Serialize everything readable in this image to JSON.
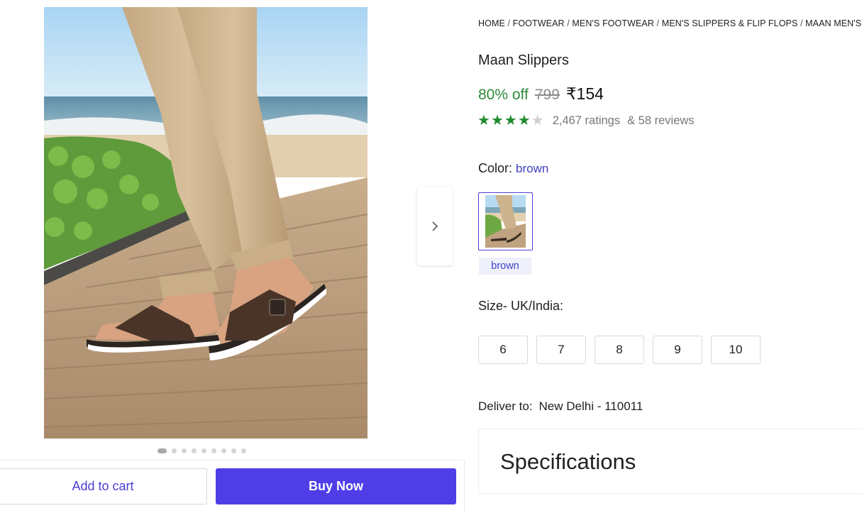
{
  "breadcrumb": [
    {
      "label": "HOME"
    },
    {
      "label": "FOOTWEAR"
    },
    {
      "label": "MEN'S FOOTWEAR"
    },
    {
      "label": "MEN'S SLIPPERS & FLIP FLOPS"
    },
    {
      "label": "MAAN MEN'S S"
    }
  ],
  "product": {
    "title": "Maan Slippers",
    "discount": "80% off",
    "mrp": "799",
    "price": "₹154",
    "rating": 4,
    "rating_max": 5,
    "ratings_text": "2,467 ratings",
    "reviews_text": "& 58 reviews"
  },
  "color": {
    "label": "Color:",
    "selected": "brown",
    "options": [
      {
        "name": "brown"
      }
    ]
  },
  "size": {
    "label": "Size- UK/India:",
    "options": [
      "6",
      "7",
      "8",
      "9",
      "10"
    ]
  },
  "delivery": {
    "label": "Deliver to:",
    "location": "New Delhi - 110011"
  },
  "specifications": {
    "title": "Specifications"
  },
  "gallery": {
    "image_count": 9,
    "active_index": 0
  },
  "actions": {
    "add_to_cart": "Add to cart",
    "buy_now": "Buy Now"
  },
  "colors": {
    "accent": "#4f3ee8",
    "discount_green": "#2e8b3a",
    "star_green": "#1f8a2f",
    "link_blue": "#3e3fc0"
  },
  "icons": {
    "next": "chevron-right-icon",
    "star": "star-icon"
  }
}
